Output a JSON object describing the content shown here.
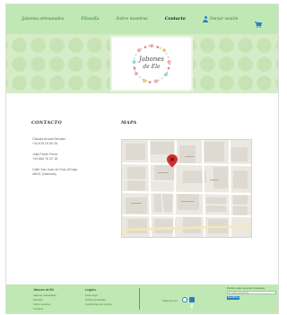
{
  "nav": {
    "items": [
      {
        "label": "Jabones artesanales"
      },
      {
        "label": "Filosofía"
      },
      {
        "label": "Sobre nosotras"
      },
      {
        "label": "Contacto"
      }
    ],
    "account_label": "Iniciar sesión",
    "colors": {
      "bar": "#bfe8b4",
      "link": "#2f7a2a",
      "active": "#1e1e1e",
      "icon": "#2a7fc4"
    }
  },
  "logo": {
    "line1": "Jabones",
    "line2": "de Ele"
  },
  "contact": {
    "title": "CONTACTO",
    "lines": [
      "Claudia Arnold Bevolen",
      "+34 676 20 65 26",
      "Julia Pardo Pérez",
      "+34 686 76 22 18",
      "Calle San Juan de Dios 26 bajo",
      "46011 (Valencia)"
    ]
  },
  "map": {
    "title": "MAPA",
    "marker_color": "#d32f2f"
  },
  "footer": {
    "col1": {
      "title": "Jabones de Ele",
      "links": [
        "Jabones artesanales",
        "Filosofía",
        "Sobre nosotras",
        "Contacto"
      ]
    },
    "col2": {
      "title": "Legales",
      "links": [
        "Aviso legal",
        "Política privacidad",
        "Condiciones de compra"
      ]
    },
    "follow_label": "Síguenos en:",
    "newsletter": {
      "title": "Recibe todas nuestras novedades",
      "placeholder": "Tu correo electrónico",
      "button": "Suscribirme"
    }
  }
}
